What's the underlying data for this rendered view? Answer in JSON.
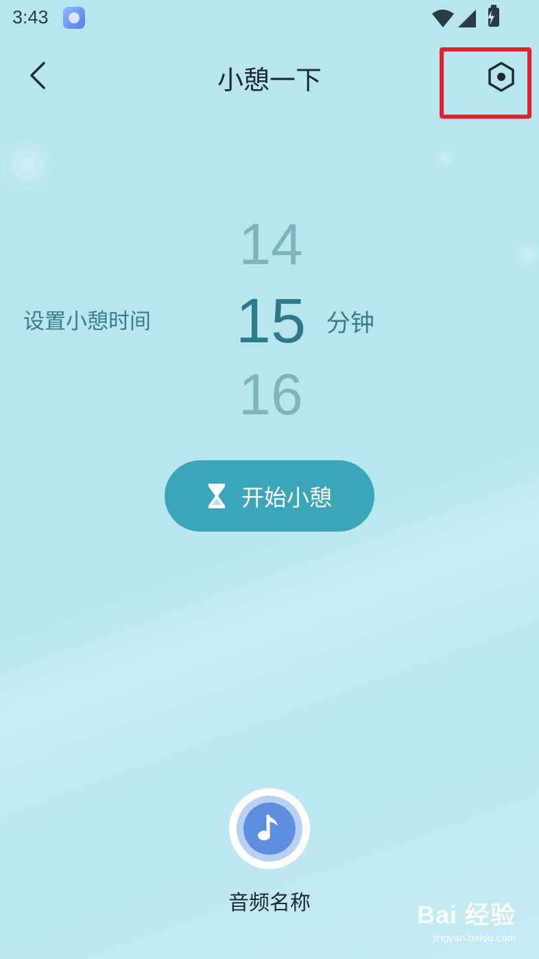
{
  "status_bar": {
    "time": "3:43"
  },
  "header": {
    "title": "小憩一下"
  },
  "picker": {
    "label": "设置小憩时间",
    "prev_value": "14",
    "current_value": "15",
    "next_value": "16",
    "unit": "分钟"
  },
  "start_button": {
    "label": "开始小憩"
  },
  "audio": {
    "name": "音频名称"
  },
  "watermark": {
    "brand": "Bai 经验",
    "sub": "jingyan.baidu.com"
  },
  "colors": {
    "background": "#b8e6ef",
    "accent": "#3ba5b9",
    "highlight": "#e3212b",
    "music": "#5e8ee0"
  },
  "icons": {
    "back": "chevron-left-icon",
    "settings": "hexagon-settings-icon",
    "hourglass": "hourglass-icon",
    "music": "music-note-icon"
  }
}
